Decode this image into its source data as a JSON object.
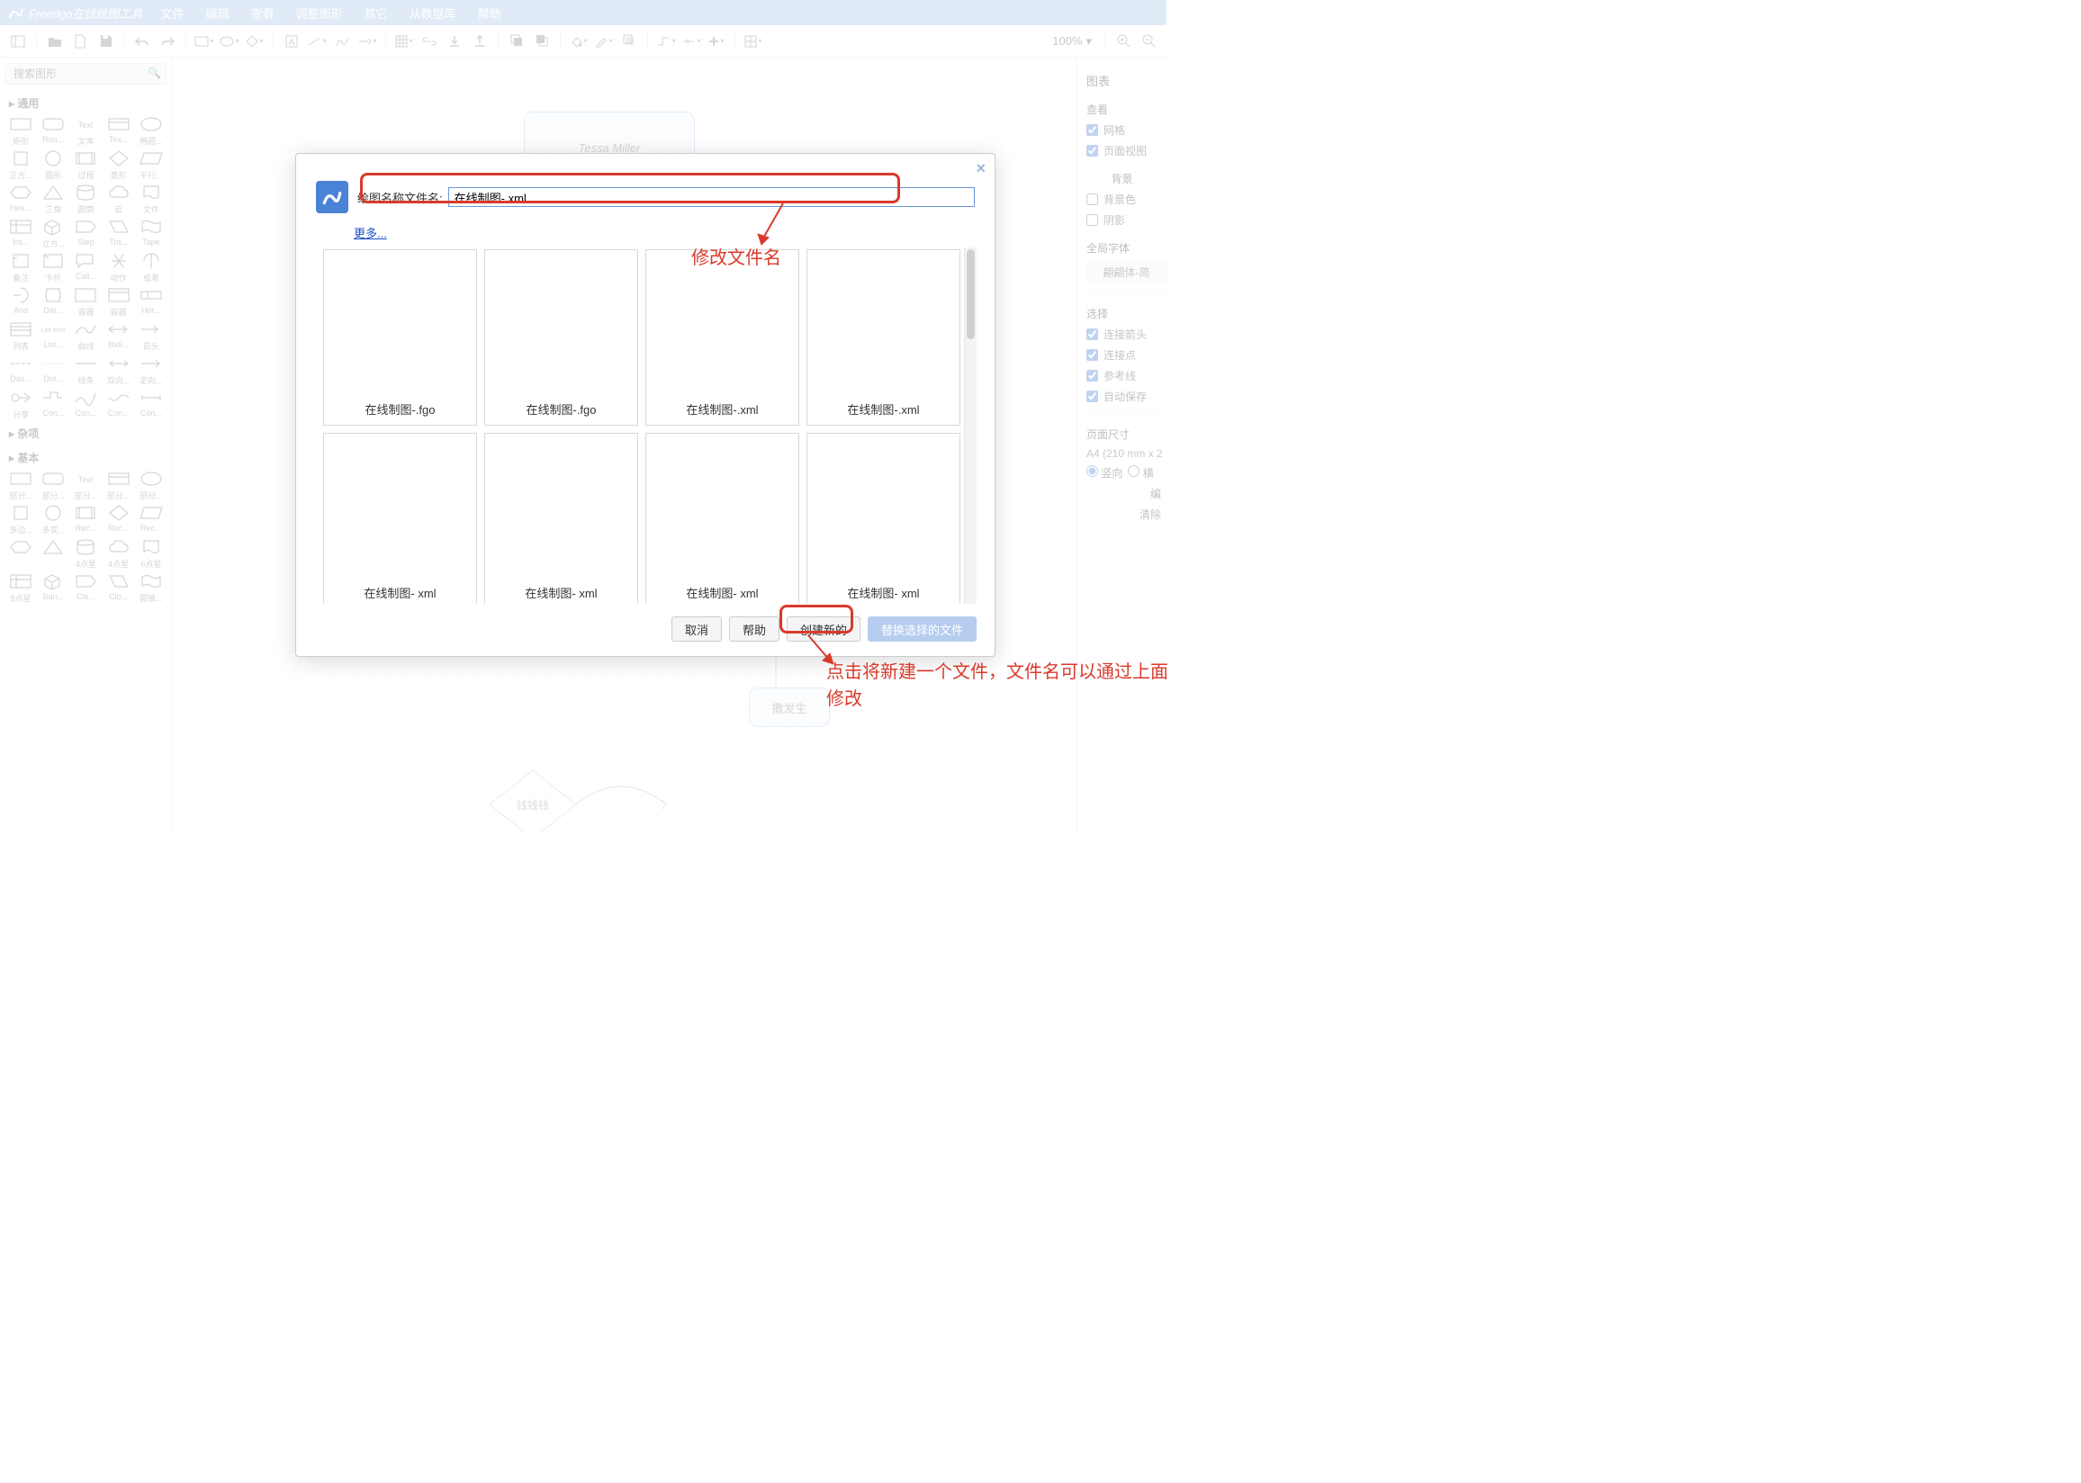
{
  "app": {
    "name": "Freedgo在线绘图工具"
  },
  "menubar": [
    "文件",
    "编辑",
    "查看",
    "调整图形",
    "其它",
    "从数据库",
    "帮助"
  ],
  "toolbar": {
    "zoom": "100%"
  },
  "search": {
    "placeholder": "搜索图形"
  },
  "shape_sections": {
    "general": {
      "title": "▸ 通用",
      "shapes": [
        {
          "l": "矩形"
        },
        {
          "l": "Rou..."
        },
        {
          "l": "文本"
        },
        {
          "l": "Tex..."
        },
        {
          "l": "椭圆..."
        },
        {
          "l": "正方..."
        },
        {
          "l": "圆形"
        },
        {
          "l": "过程"
        },
        {
          "l": "菱形"
        },
        {
          "l": "平行..."
        },
        {
          "l": "Hex..."
        },
        {
          "l": "三角"
        },
        {
          "l": "圆筒"
        },
        {
          "l": "云"
        },
        {
          "l": "文件"
        },
        {
          "l": "Int..."
        },
        {
          "l": "立方..."
        },
        {
          "l": "Step"
        },
        {
          "l": "Tra..."
        },
        {
          "l": "Tape"
        },
        {
          "l": "备注"
        },
        {
          "l": "卡片"
        },
        {
          "l": "Call..."
        },
        {
          "l": "动作"
        },
        {
          "l": "或者"
        },
        {
          "l": "And"
        },
        {
          "l": "Dat..."
        },
        {
          "l": "容器"
        },
        {
          "l": "容器"
        },
        {
          "l": "Hor..."
        },
        {
          "l": "列表"
        },
        {
          "l": "List..."
        },
        {
          "l": "曲线"
        },
        {
          "l": "Bidi..."
        },
        {
          "l": "箭头"
        },
        {
          "l": "Das..."
        },
        {
          "l": "Dot..."
        },
        {
          "l": "线条"
        },
        {
          "l": "双向..."
        },
        {
          "l": "定向..."
        },
        {
          "l": "分享"
        },
        {
          "l": "Con..."
        },
        {
          "l": "Con..."
        },
        {
          "l": "Con..."
        },
        {
          "l": "Con..."
        }
      ]
    },
    "misc": {
      "title": "▸ 杂项"
    },
    "basic": {
      "title": "▸ 基本",
      "shapes": [
        {
          "l": "部分..."
        },
        {
          "l": "部分..."
        },
        {
          "l": "部分..."
        },
        {
          "l": "部分..."
        },
        {
          "l": "部分..."
        },
        {
          "l": "多边..."
        },
        {
          "l": "多变..."
        },
        {
          "l": "Rec..."
        },
        {
          "l": "Rec..."
        },
        {
          "l": "Rec..."
        },
        {
          "l": ""
        },
        {
          "l": ""
        },
        {
          "l": "4点星"
        },
        {
          "l": "4点星"
        },
        {
          "l": "6点星"
        },
        {
          "l": "8点星"
        },
        {
          "l": "Ban..."
        },
        {
          "l": "Clo..."
        },
        {
          "l": "Clo..."
        },
        {
          "l": "圆锥..."
        }
      ]
    }
  },
  "canvas": {
    "node_a": "Tessa Miller",
    "node_b": "撒发生",
    "diamond": "钱钱钱"
  },
  "right": {
    "title": "图表",
    "view_sub": "查看",
    "grid": "网格",
    "pageview": "页面视图",
    "bg_sub": "背景",
    "bgcolor": "背景色",
    "shadow": "阴影",
    "font_sub": "全局字体",
    "font_val": "翩翩体-简",
    "sel_sub": "选择",
    "conn_arrow": "连接箭头",
    "conn_point": "连接点",
    "guide": "参考线",
    "autosave": "自动保存",
    "page_sub": "页面尺寸",
    "page_size": "A4 (210 mm x 2",
    "portrait": "竖向",
    "landscape": "横",
    "edit": "编",
    "clear": "清除"
  },
  "modal": {
    "fname_label": "绘图名称文件名:",
    "fname_value": "在线制图-.xml",
    "more": "更多...",
    "templates": [
      "在线制图-.fgo",
      "在线制图-.fgo",
      "在线制图-.xml",
      "在线制图-.xml",
      "在线制图- xml",
      "在线制图- xml",
      "在线制图- xml",
      "在线制图- xml"
    ],
    "btn_cancel": "取消",
    "btn_help": "帮助",
    "btn_create": "创建新的",
    "btn_replace": "替换选择的文件"
  },
  "annotations": {
    "t1": "修改文件名",
    "t2": "点击将新建一个文件，文件名可以通过上面修改"
  }
}
